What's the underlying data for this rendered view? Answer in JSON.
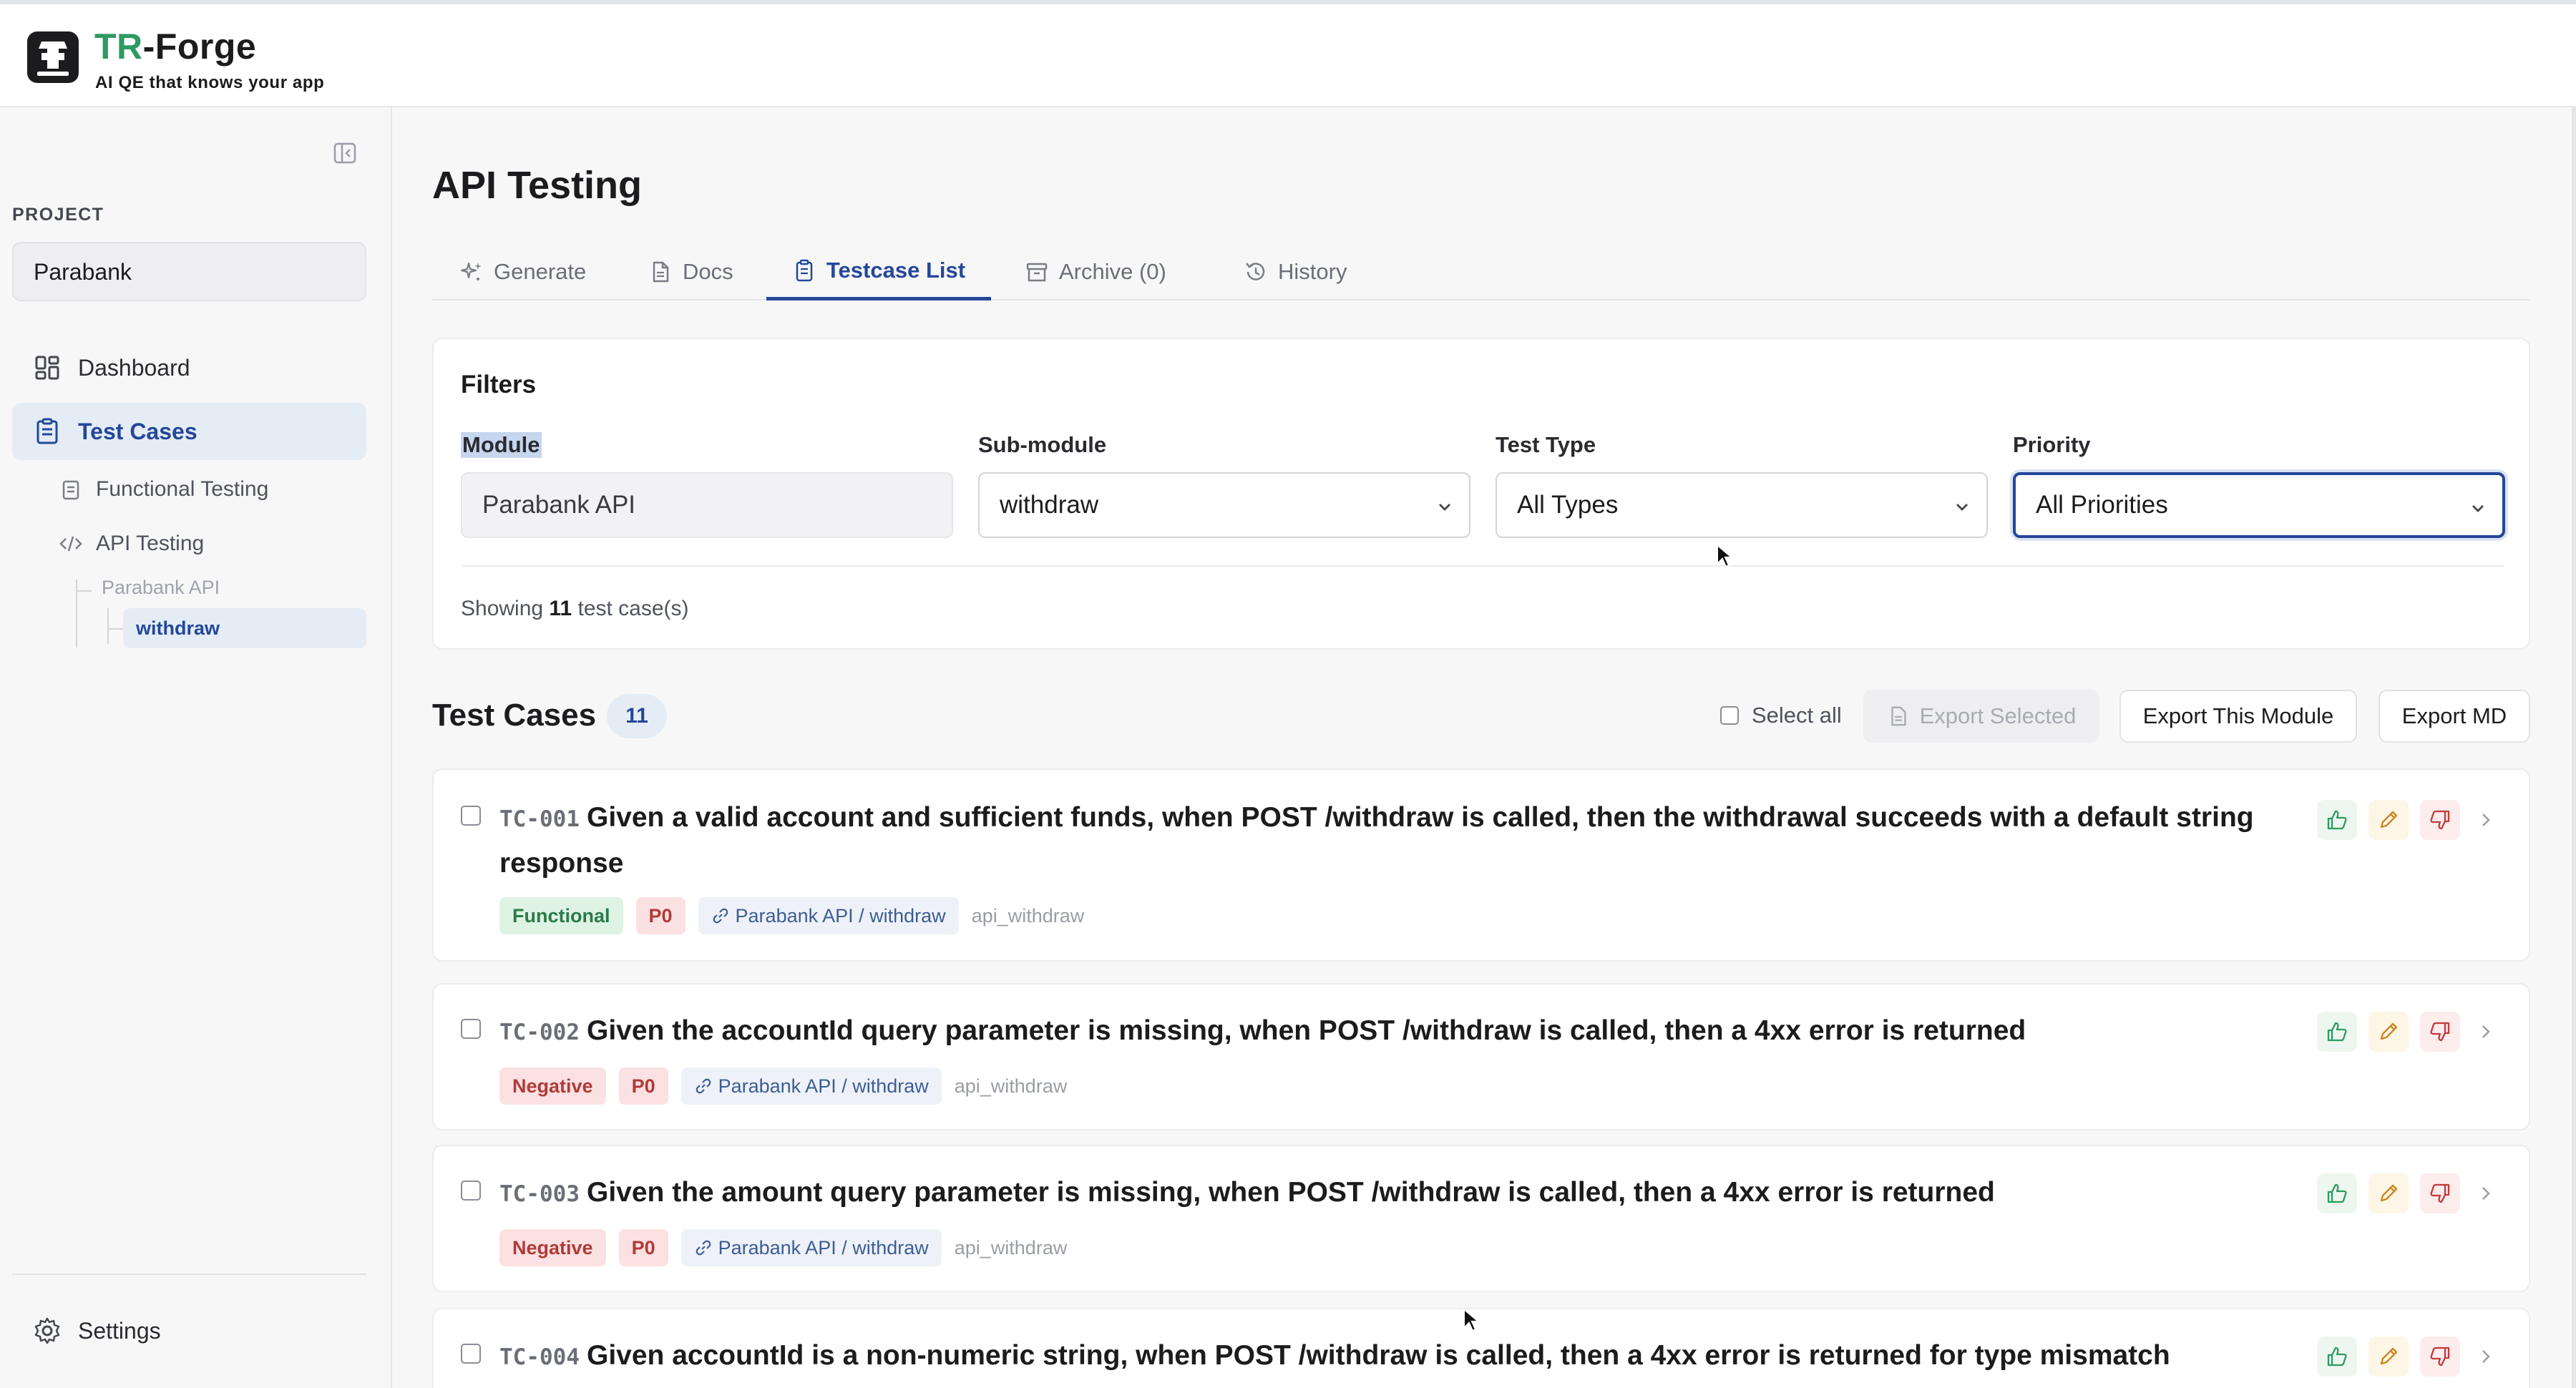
{
  "app": {
    "name_part1": "TR",
    "name_part2": "-Forge",
    "tagline": "AI QE that knows your app"
  },
  "sidebar": {
    "project_label": "PROJECT",
    "project_value": "Parabank",
    "items": [
      {
        "label": "Dashboard",
        "icon": "dashboard-icon"
      },
      {
        "label": "Test Cases",
        "icon": "clipboard-icon",
        "active": true
      }
    ],
    "sub_items": [
      {
        "label": "Functional Testing",
        "icon": "clipboard-icon"
      },
      {
        "label": "API Testing",
        "icon": "code-icon"
      }
    ],
    "tree": {
      "parent": "Parabank API",
      "active_child": "withdraw"
    },
    "settings_label": "Settings"
  },
  "main": {
    "title": "API Testing",
    "tabs": [
      {
        "label": "Generate",
        "icon": "sparkles-icon"
      },
      {
        "label": "Docs",
        "icon": "document-icon"
      },
      {
        "label": "Testcase List",
        "icon": "clipboard-icon",
        "active": true
      },
      {
        "label": "Archive (0)",
        "icon": "archive-icon"
      },
      {
        "label": "History",
        "icon": "history-icon"
      }
    ],
    "filters": {
      "title": "Filters",
      "module_label": "Module",
      "module_value": "Parabank API",
      "submodule_label": "Sub-module",
      "submodule_value": "withdraw",
      "testtype_label": "Test Type",
      "testtype_value": "All Types",
      "priority_label": "Priority",
      "priority_value": "All Priorities",
      "showing_prefix": "Showing",
      "showing_count": "11",
      "showing_suffix": "test case(s)"
    },
    "testcases_header": {
      "title": "Test Cases",
      "count": "11",
      "select_all": "Select all",
      "export_selected": "Export Selected",
      "export_module": "Export This Module",
      "export_md": "Export MD"
    },
    "testcases": [
      {
        "id": "TC-001",
        "title": "Given a valid account and sufficient funds, when POST /withdraw is called, then the withdrawal succeeds with a default string response",
        "type": "Functional",
        "priority": "P0",
        "path": "Parabank API / withdraw",
        "tag": "api_withdraw"
      },
      {
        "id": "TC-002",
        "title": "Given the accountId query parameter is missing, when POST /withdraw is called, then a 4xx error is returned",
        "type": "Negative",
        "priority": "P0",
        "path": "Parabank API / withdraw",
        "tag": "api_withdraw"
      },
      {
        "id": "TC-003",
        "title": "Given the amount query parameter is missing, when POST /withdraw is called, then a 4xx error is returned",
        "type": "Negative",
        "priority": "P0",
        "path": "Parabank API / withdraw",
        "tag": "api_withdraw"
      },
      {
        "id": "TC-004",
        "title": "Given accountId is a non-numeric string, when POST /withdraw is called, then a 4xx error is returned for type mismatch"
      }
    ]
  },
  "colors": {
    "accent": "#25479a",
    "brand_green": "#2d9a61",
    "negative": "#b03a3a",
    "functional": "#2a7a48"
  }
}
